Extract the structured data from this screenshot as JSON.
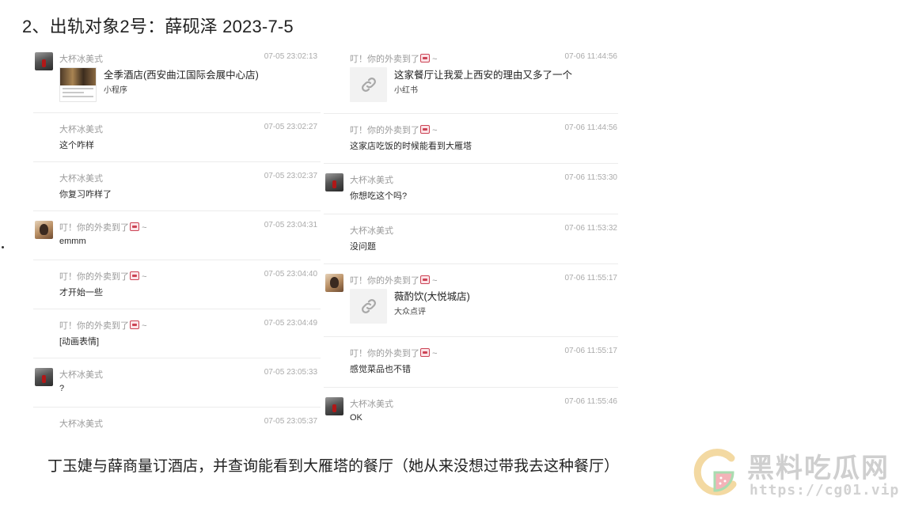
{
  "heading": "2、出轨对象2号：薛砚泽 2023-7-5",
  "left_messages": [
    {
      "sender": "大杯冰美式",
      "time": "07-05 23:02:13",
      "avatar": "dark",
      "card": {
        "title": "全季酒店(西安曲江国际会展中心店)",
        "source": "小程序",
        "thumb": "hotel-photo"
      }
    },
    {
      "sender": "大杯冰美式",
      "time": "07-05 23:02:27",
      "text": "这个咋样"
    },
    {
      "sender": "大杯冰美式",
      "time": "07-05 23:02:37",
      "text": "你复习咋样了"
    },
    {
      "sender": "叮！你的外卖到了",
      "emoji": true,
      "suffix": "~",
      "time": "07-05 23:04:31",
      "avatar": "light",
      "text": "emmm"
    },
    {
      "sender": "叮！你的外卖到了",
      "emoji": true,
      "suffix": "~",
      "time": "07-05 23:04:40",
      "text": "才开始一些"
    },
    {
      "sender": "叮！你的外卖到了",
      "emoji": true,
      "suffix": "~",
      "time": "07-05 23:04:49",
      "text": "[动画表情]"
    },
    {
      "sender": "大杯冰美式",
      "time": "07-05 23:05:33",
      "avatar": "dark",
      "text": "?"
    },
    {
      "sender": "大杯冰美式",
      "time": "07-05 23:05:37",
      "text": "！！！"
    }
  ],
  "right_messages": [
    {
      "sender": "叮！你的外卖到了",
      "emoji": true,
      "suffix": "~",
      "time": "07-06 11:44:56",
      "card": {
        "title": "这家餐厅让我爱上西安的理由又多了一个",
        "source": "小红书",
        "thumb": "link-icon"
      }
    },
    {
      "sender": "叮！你的外卖到了",
      "emoji": true,
      "suffix": "~",
      "time": "07-06 11:44:56",
      "text": "这家店吃饭的时候能看到大雁塔"
    },
    {
      "sender": "大杯冰美式",
      "time": "07-06 11:53:30",
      "avatar": "dark",
      "text": "你想吃这个吗?"
    },
    {
      "sender": "大杯冰美式",
      "time": "07-06 11:53:32",
      "text": "没问题"
    },
    {
      "sender": "叮！你的外卖到了",
      "emoji": true,
      "suffix": "~",
      "time": "07-06 11:55:17",
      "avatar": "light",
      "card": {
        "title": "薇酌饮(大悦城店)",
        "source": "大众点评",
        "thumb": "link-icon"
      }
    },
    {
      "sender": "叮！你的外卖到了",
      "emoji": true,
      "suffix": "~",
      "time": "07-06 11:55:17",
      "text": "感觉菜品也不错"
    },
    {
      "sender": "大杯冰美式",
      "time": "07-06 11:55:46",
      "avatar": "dark",
      "text": "OK"
    }
  ],
  "caption": "丁玉婕与薛商量订酒店，并查询能看到大雁塔的餐厅（她从来没想过带我去这种餐厅）",
  "watermark": {
    "title": "黑料吃瓜网",
    "url": "https://cg01.vip"
  },
  "colors": {
    "text": "#222222",
    "meta": "#9a9a9a",
    "divider": "#ececec",
    "watermark": "#cfcfcf"
  }
}
